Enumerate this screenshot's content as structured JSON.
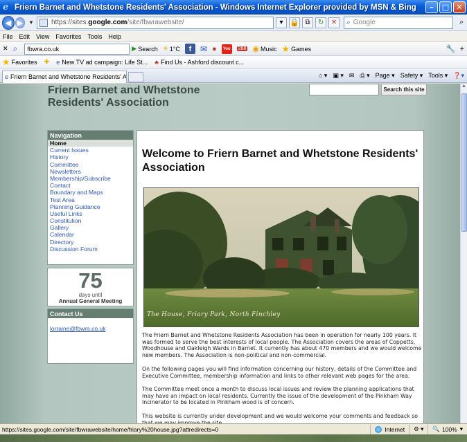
{
  "window": {
    "title": "Friern Barnet and Whetstone Residents' Association - Windows Internet Explorer provided by MSN & Bing",
    "minimize": "–",
    "maximize": "□",
    "close": "✕"
  },
  "address": {
    "url_proto": "https://sites.",
    "url_domain": "google.com",
    "url_path": "/site/fbwrawebsite/",
    "search_placeholder": "Google"
  },
  "menu": [
    "File",
    "Edit",
    "View",
    "Favorites",
    "Tools",
    "Help"
  ],
  "toolbar": {
    "search_value": "fbwra.co.uk",
    "search_label": "Search",
    "weather": "1°C",
    "mail_badge": "288",
    "music": "Music",
    "games": "Games"
  },
  "favorites": {
    "label": "Favorites",
    "items": [
      "New TV ad campaign: Life St...",
      "Find Us - Ashford discount c..."
    ]
  },
  "tab": {
    "title": "Friern Barnet and Whetstone Residents' Association",
    "commands": [
      "Page ▾",
      "Safety ▾",
      "Tools ▾"
    ]
  },
  "site": {
    "title": "Friern Barnet and Whetstone Residents' Association",
    "search_button": "Search this site",
    "navigation_heading": "Navigation",
    "nav_items": [
      "Home",
      "Current Issues",
      "History",
      "Committee",
      "Newsletters",
      "Membership/Subscribe",
      "Contact",
      "Boundary and Maps",
      "Test Area",
      "Planning Guidance",
      "Useful Links",
      "Constitution",
      "Gallery",
      "Calendar",
      "Directory",
      "Discussion Forum"
    ],
    "countdown": {
      "number": "75",
      "unit": "days until",
      "event": "Annual General Meeting"
    },
    "contact_heading": "Contact Us",
    "contact_email": "lorraine@fbwra.co.uk"
  },
  "main": {
    "heading": "Welcome to Friern Barnet and Whetstone Residents' Association",
    "photo_caption": "The House, Friary Park, North Finchley",
    "paragraphs": [
      "The Friern Barnet and Whetstone Residents Association has been in operation for nearly 100 years. It was formed to serve the best interests of local people. The Association covers the areas of Coppetts, Woodhouse and Oakleigh Wards in Barnet. It currently has about 470 members and we would welcome new members. The Association is non-political and non-commercial.",
      "On the following pages you will find information concerning our history, details of the Committee and Executive Committee, membership information and links to other relevant web pages for the area.",
      "The Committee meet once a month to discuss local issues and review the planning applications that may have an impact on local residents. Currently the issue of the development of the Pinkham Way Incinerator to be located in Pinkham wood is of concern.",
      "This website is currently under development and we would welcome your comments and feedback so that we may improve the site."
    ]
  },
  "status": {
    "url": "https://sites.google.com/site/fbwrawebsite/home/friary%20house.jpg?attredirects=0",
    "zone": "Internet",
    "zoom": "100%"
  }
}
